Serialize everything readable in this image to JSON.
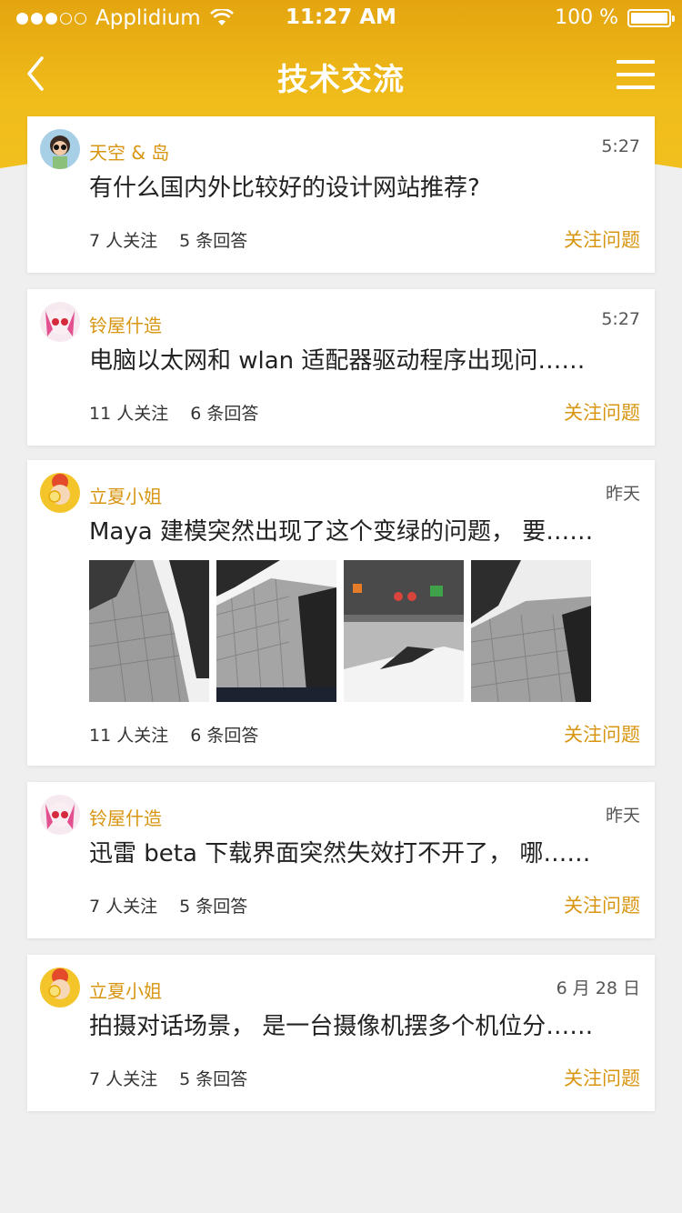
{
  "status_bar": {
    "carrier": "Applidium",
    "time": "11:27 AM",
    "battery": "100 %"
  },
  "nav": {
    "title": "技术交流",
    "back_icon": "chevron-left-icon",
    "menu_icon": "hamburger-menu-icon"
  },
  "colors": {
    "accent": "#f0bd1b",
    "accent_dark": "#e4a50f",
    "author_text": "#d89511",
    "follow_text": "#d89511"
  },
  "posts": [
    {
      "author": "天空 & 岛",
      "time": "5:27",
      "question": "有什么国内外比较好的设计网站推荐?",
      "followers": "7 人关注",
      "answers": "5 条回答",
      "follow_label": "关注问题"
    },
    {
      "author": "铃屋什造",
      "time": "5:27",
      "question": "电脑以太网和 wlan 适配器驱动程序出现问……",
      "followers": "11 人关注",
      "answers": "6 条回答",
      "follow_label": "关注问题"
    },
    {
      "author": "立夏小姐",
      "time": "昨天",
      "question": "Maya 建模突然出现了这个变绿的问题， 要……",
      "followers": "11 人关注",
      "answers": "6 条回答",
      "follow_label": "关注问题"
    },
    {
      "author": "铃屋什造",
      "time": "昨天",
      "question": "迅雷 beta 下载界面突然失效打不开了， 哪……",
      "followers": "7 人关注",
      "answers": "5 条回答",
      "follow_label": "关注问题"
    },
    {
      "author": "立夏小姐",
      "time": "6 月 28 日",
      "question": "拍摄对话场景， 是一台摄像机摆多个机位分……",
      "followers": "7 人关注",
      "answers": "5 条回答",
      "follow_label": "关注问题"
    }
  ]
}
